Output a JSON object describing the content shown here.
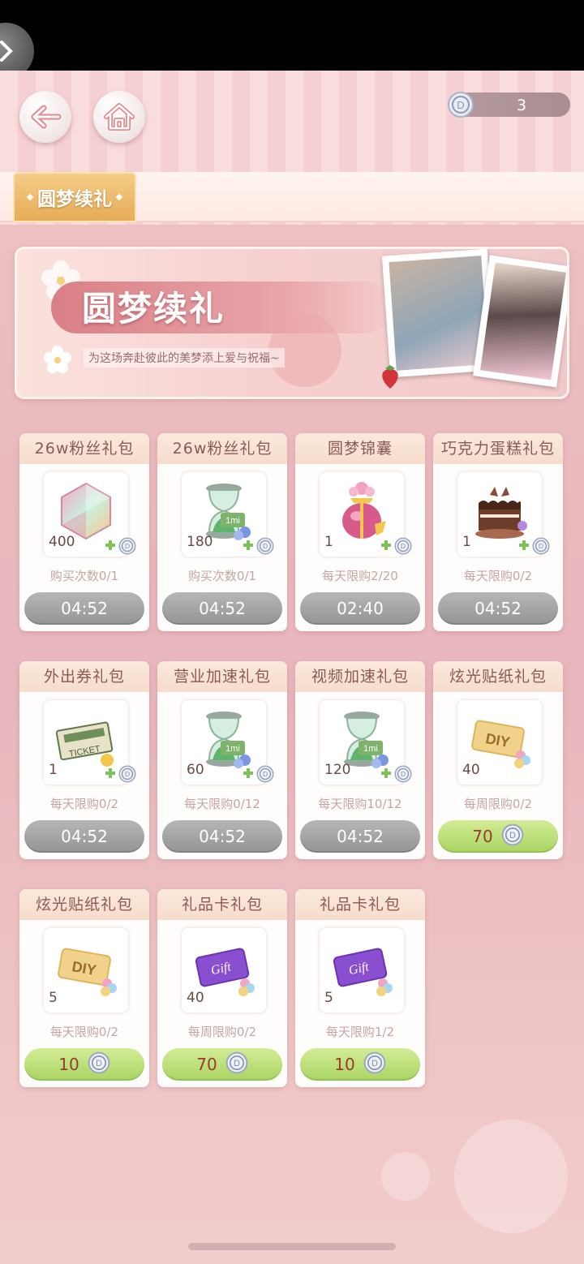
{
  "header": {
    "currency_amount": "3"
  },
  "tab": {
    "active_label": "圆梦续礼"
  },
  "banner": {
    "title": "圆梦续礼",
    "subtitle": "为这场奔赴彼此的美梦添上爱与祝福~"
  },
  "cards": [
    {
      "title": "26w粉丝礼包",
      "qty": "400",
      "icon": "crystal-icon",
      "limit": "购买次数0/1",
      "button": "04:52",
      "button_type": "timer"
    },
    {
      "title": "26w粉丝礼包",
      "qty": "180",
      "icon": "hourglass-icon",
      "limit": "购买次数0/1",
      "button": "04:52",
      "button_type": "timer"
    },
    {
      "title": "圆梦锦囊",
      "qty": "1",
      "icon": "pouch-icon",
      "limit": "每天限购2/20",
      "button": "02:40",
      "button_type": "timer"
    },
    {
      "title": "巧克力蛋糕礼包",
      "qty": "1",
      "icon": "cake-icon",
      "limit": "每天限购0/2",
      "button": "04:52",
      "button_type": "timer"
    },
    {
      "title": "外出券礼包",
      "qty": "1",
      "icon": "ticket-icon",
      "limit": "每天限购0/2",
      "button": "04:52",
      "button_type": "timer"
    },
    {
      "title": "营业加速礼包",
      "qty": "60",
      "icon": "hourglass-icon",
      "limit": "每天限购0/12",
      "button": "04:52",
      "button_type": "timer"
    },
    {
      "title": "视频加速礼包",
      "qty": "120",
      "icon": "hourglass-icon",
      "limit": "每天限购10/12",
      "button": "04:52",
      "button_type": "timer"
    },
    {
      "title": "炫光贴纸礼包",
      "qty": "40",
      "icon": "diy-sticker-icon",
      "limit": "每周限购0/2",
      "button": "70",
      "button_type": "price"
    },
    {
      "title": "炫光贴纸礼包",
      "qty": "5",
      "icon": "diy-sticker-icon",
      "limit": "每天限购0/2",
      "button": "10",
      "button_type": "price"
    },
    {
      "title": "礼品卡礼包",
      "qty": "40",
      "icon": "gift-card-icon",
      "limit": "每周限购0/2",
      "button": "70",
      "button_type": "price"
    },
    {
      "title": "礼品卡礼包",
      "qty": "5",
      "icon": "gift-card-icon",
      "limit": "每天限购1/2",
      "button": "10",
      "button_type": "price"
    }
  ],
  "colors": {
    "timer_button": "#a3a3a3",
    "price_button": "#b9dd75",
    "price_text": "#9b3a2e",
    "tab_active": "#eeb866"
  }
}
